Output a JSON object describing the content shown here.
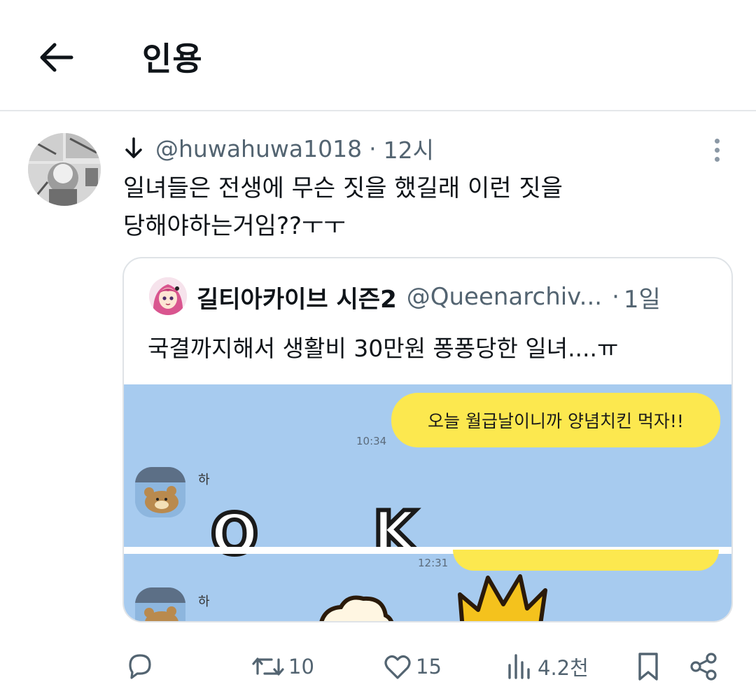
{
  "header": {
    "title": "인용"
  },
  "tweet": {
    "handle": "@huwahuwa1018",
    "separator": "·",
    "time": "12시",
    "text_line1": "일녀들은 전생에 무슨 짓을 했길래 이런 짓을",
    "text_line2": "당해야하는거임??ㅜㅜ"
  },
  "quote": {
    "name": "길티아카이브 시즌2",
    "handle": "@Queenarchiv...",
    "separator": "·",
    "time": "1일",
    "text": "국결까지해서 생활비 30만원 퐁퐁당한 일녀....ㅠ",
    "media": {
      "bubble_text": "오늘 월급날이니까 양념치킨 먹자!!",
      "time1": "10:34",
      "sender1": "하",
      "letter_o": "O",
      "letter_k": "K",
      "time2": "12:31",
      "sender2": "하"
    }
  },
  "actions": {
    "reply_icon": "reply-icon",
    "retweet_count": "10",
    "like_count": "15",
    "views_count": "4.2천",
    "bookmark_icon": "bookmark-icon",
    "share_icon": "share-icon"
  },
  "colors": {
    "text_primary": "#0f1419",
    "text_secondary": "#536471",
    "divider": "#e4e7ea",
    "chat_bg": "#a7cbef",
    "bubble_yellow": "#fce84f"
  }
}
